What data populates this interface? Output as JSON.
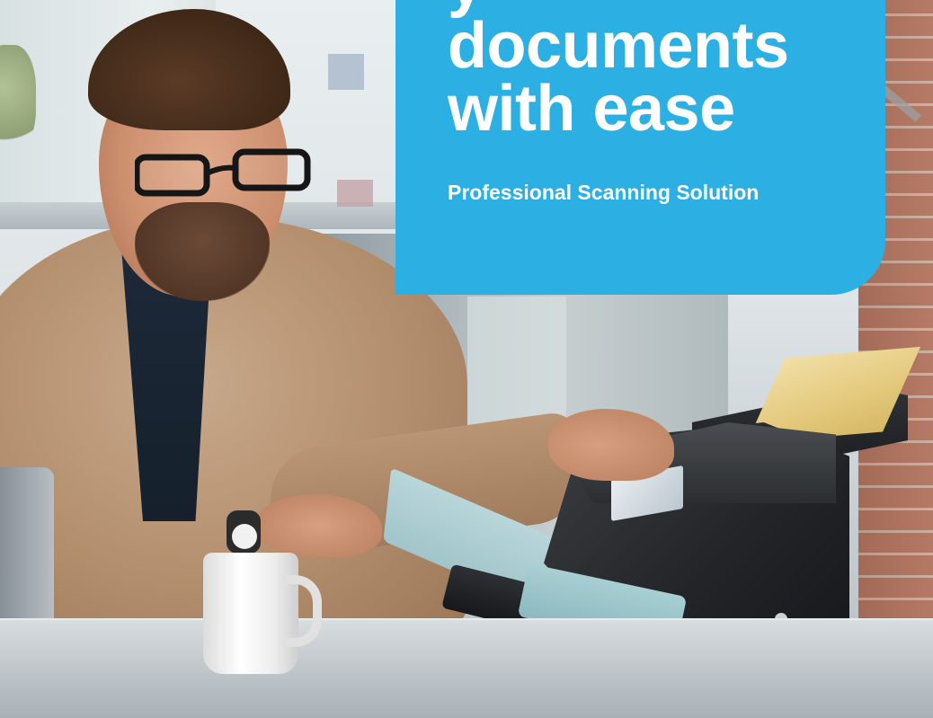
{
  "banner": {
    "headline_lines": [
      "y",
      "documents",
      "with ease"
    ],
    "subheadline": "Professional Scanning Solution",
    "background_color": "#2cb0e3",
    "text_color": "#ffffff"
  },
  "photo": {
    "subject": "man-with-glasses",
    "objects": [
      "document-scanner",
      "coffee-mug",
      "laptop",
      "paper-sheet",
      "wristwatch"
    ]
  }
}
